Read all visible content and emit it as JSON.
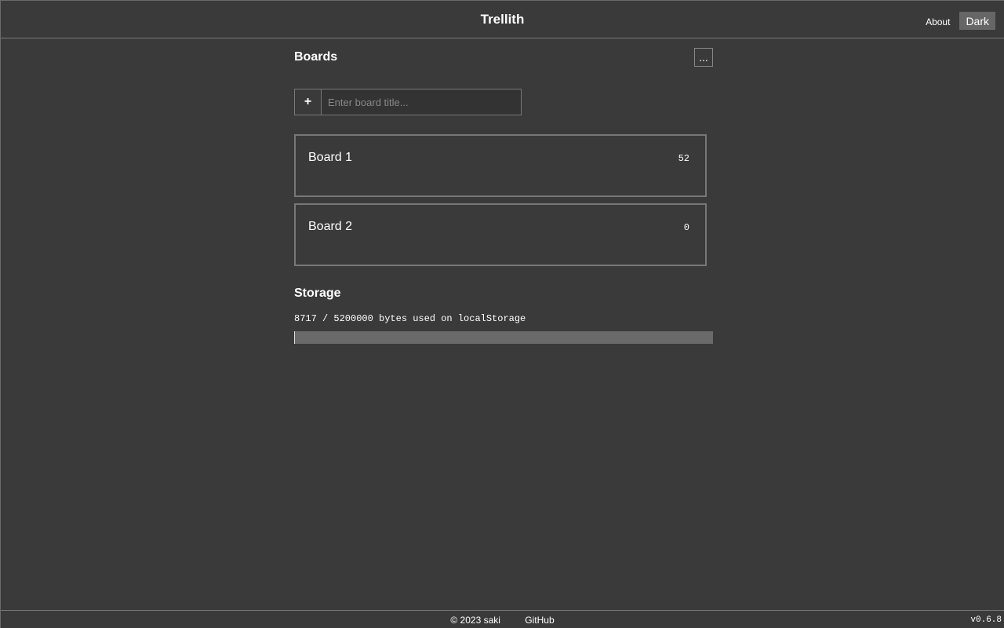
{
  "header": {
    "title": "Trellith",
    "about_label": "About",
    "theme_label": "Dark"
  },
  "boards_section": {
    "title": "Boards",
    "more_label": "...",
    "add_label": "+",
    "input_placeholder": "Enter board title...",
    "input_value": "",
    "boards": [
      {
        "name": "Board 1",
        "count": "52"
      },
      {
        "name": "Board 2",
        "count": "0"
      }
    ]
  },
  "storage": {
    "title": "Storage",
    "usage_text": "8717 / 5200000 bytes used on localStorage",
    "used_bytes": 8717,
    "total_bytes": 5200000
  },
  "footer": {
    "copyright": "© 2023 saki",
    "github_label": "GitHub",
    "version": "v0.6.8"
  },
  "colors": {
    "background": "#3a3a3a",
    "border": "#777777",
    "bar_track": "#6a6a6a",
    "theme_button": "#666666"
  }
}
